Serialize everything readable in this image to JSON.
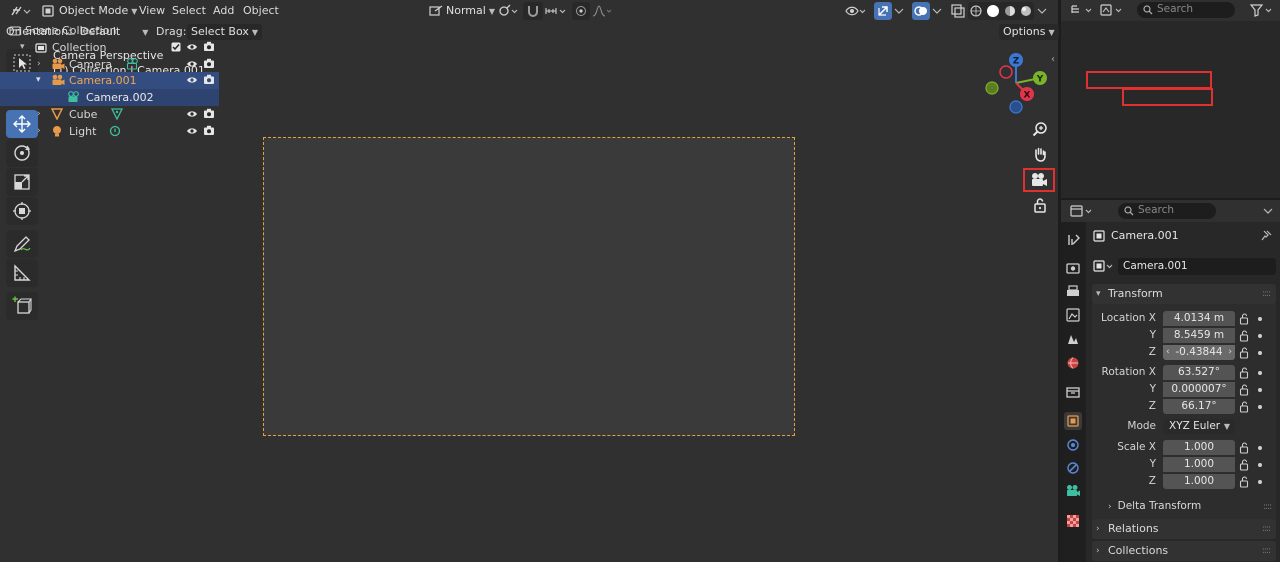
{
  "header": {
    "mode_label": "Object Mode",
    "menus": [
      "View",
      "Select",
      "Add",
      "Object"
    ],
    "transform_orientation": "Normal"
  },
  "subheader": {
    "orientation_label": "Orientation:",
    "orientation_value": "Default",
    "drag_label": "Drag:",
    "drag_value": "Select Box",
    "options_label": "Options"
  },
  "viewport": {
    "view_name": "Camera Perspective",
    "collection_info": "(1) Collection | Camera.001",
    "gizmo_labels": {
      "x": "X",
      "y": "Y",
      "z": "Z"
    }
  },
  "outliner": {
    "search_placeholder": "Search",
    "scene_collection": "Scene Collection",
    "items": [
      {
        "name": "Collection"
      },
      {
        "name": "Camera"
      },
      {
        "name": "Camera.001"
      },
      {
        "name": "Camera.002"
      },
      {
        "name": "Cube"
      },
      {
        "name": "Light"
      }
    ]
  },
  "properties": {
    "search_placeholder": "Search",
    "object_name": "Camera.001",
    "object_field": "Camera.001",
    "transform_title": "Transform",
    "location_label": "Location X",
    "location": {
      "x": "4.0134 m",
      "y": "8.5459 m",
      "z": "-0.43844"
    },
    "rotation_label": "Rotation X",
    "rotation": {
      "x": "63.527°",
      "y": "0.000007°",
      "z": "66.17°"
    },
    "mode_label": "Mode",
    "mode_value": "XYZ Euler",
    "scale_label": "Scale X",
    "scale": {
      "x": "1.000",
      "y": "1.000",
      "z": "1.000"
    },
    "axis_y": "Y",
    "axis_z": "Z",
    "delta_transform": "Delta Transform",
    "relations": "Relations",
    "collections": "Collections"
  },
  "colors": {
    "accent": "#4772b3",
    "selection": "#334d80",
    "highlight_box": "#e03030",
    "camera_frame": "#e5a040",
    "camera_icon": "#e69a4a",
    "camera_data_icon": "#3ec0a0"
  }
}
